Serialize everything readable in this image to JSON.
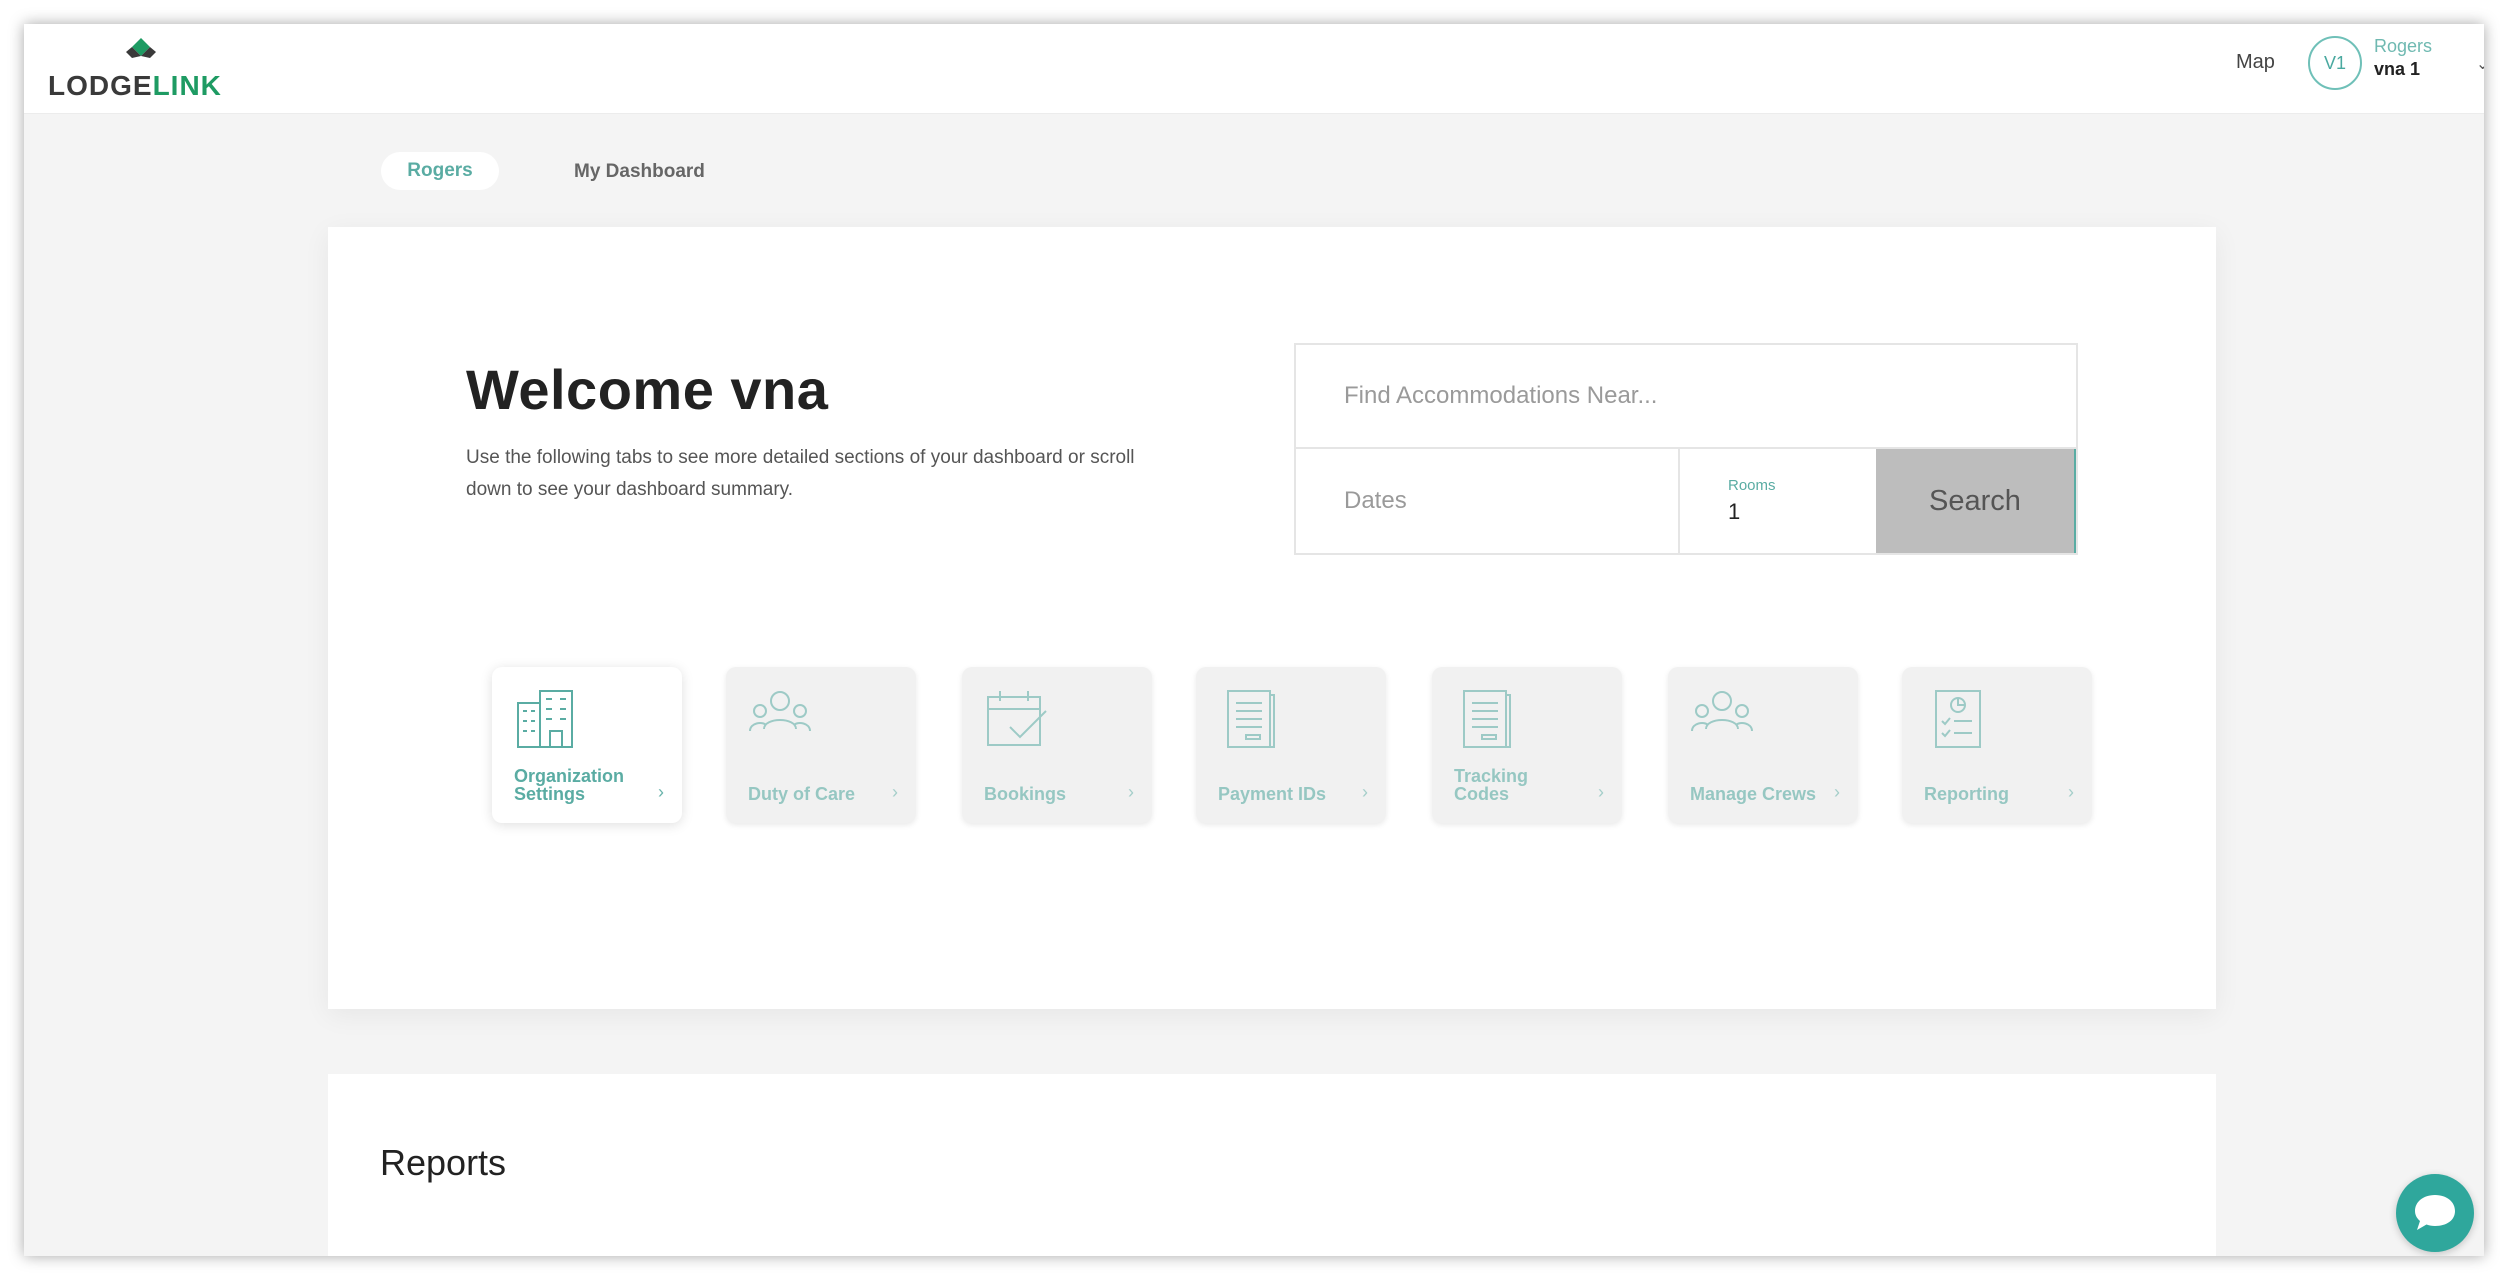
{
  "brand": {
    "logo_left": "LODGE",
    "logo_right": "LINK",
    "color_primary": "#1e9b63",
    "color_teal": "#5aaca3"
  },
  "header": {
    "map_link": "Map",
    "avatar_initials": "V1",
    "user_org": "Rogers",
    "user_name": "vna 1",
    "user_menu_icon": "chevron-down-icon"
  },
  "tabs": [
    {
      "label": "Rogers",
      "active": true
    },
    {
      "label": "My Dashboard",
      "active": false
    }
  ],
  "welcome": {
    "title": "Welcome vna",
    "text": "Use the following tabs to see more detailed sections of your dashboard or scroll down to see your dashboard summary."
  },
  "search": {
    "near_placeholder": "Find Accommodations Near...",
    "dates_placeholder": "Dates",
    "rooms_label": "Rooms",
    "rooms_value": "1",
    "button_label": "Search"
  },
  "tiles": [
    {
      "label": "Organization Settings",
      "icon": "building-icon",
      "active": true
    },
    {
      "label": "Duty of Care",
      "icon": "people-icon",
      "active": false
    },
    {
      "label": "Bookings",
      "icon": "calendar-check-icon",
      "active": false
    },
    {
      "label": "Payment IDs",
      "icon": "document-icon",
      "active": false
    },
    {
      "label": "Tracking Codes",
      "icon": "document-icon",
      "active": false
    },
    {
      "label": "Manage Crews",
      "icon": "people-icon",
      "active": false
    },
    {
      "label": "Reporting",
      "icon": "report-checklist-icon",
      "active": false
    }
  ],
  "reports": {
    "title": "Reports"
  },
  "chat": {
    "icon": "chat-bubble-icon"
  }
}
